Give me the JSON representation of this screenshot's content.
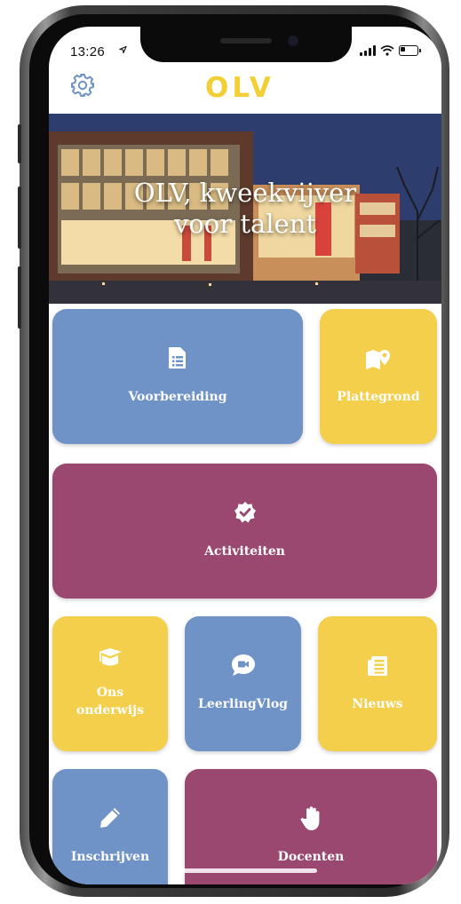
{
  "status": {
    "time": "13:26"
  },
  "header": {
    "logo": "OLV",
    "settings_icon": "gear-icon"
  },
  "hero": {
    "title_line1": "OLV, kweekvijver",
    "title_line2": "voor talent"
  },
  "tiles": {
    "voorbereiding": {
      "label": "Voorbereiding",
      "icon": "document-list-icon",
      "color": "#6f93c6"
    },
    "plattegrond": {
      "label": "Plattegrond",
      "icon": "map-pin-icon",
      "color": "#f3cf4c"
    },
    "activiteiten": {
      "label": "Activiteiten",
      "icon": "verified-badge-icon",
      "color": "#9a4870"
    },
    "ons_onderwijs": {
      "label_line1": "Ons",
      "label_line2": "onderwijs",
      "icon": "graduation-cap-icon",
      "color": "#f3cf4c"
    },
    "leerlingvlog": {
      "label": "LeerlingVlog",
      "icon": "video-chat-icon",
      "color": "#6f93c6"
    },
    "nieuws": {
      "label": "Nieuws",
      "icon": "newspaper-icon",
      "color": "#f3cf4c"
    },
    "inschrijven": {
      "label": "Inschrijven",
      "icon": "pencil-icon",
      "color": "#6f93c6"
    },
    "docenten": {
      "label": "Docenten",
      "icon": "hand-icon",
      "color": "#9a4870"
    }
  }
}
